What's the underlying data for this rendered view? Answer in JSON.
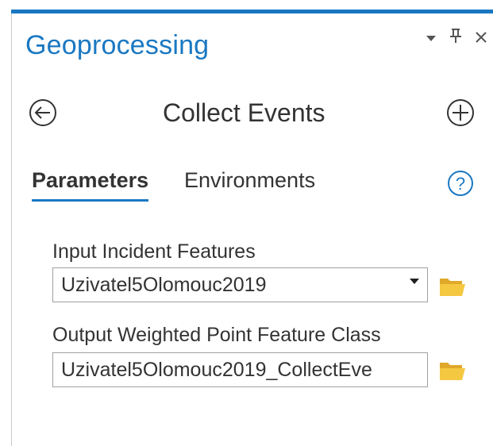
{
  "panel": {
    "title": "Geoprocessing",
    "accent_color": "#1a78c2",
    "controls": [
      {
        "name": "dropdown-menu-icon",
        "glyph": "▾"
      },
      {
        "name": "pin-icon",
        "glyph": "Ⴈ"
      },
      {
        "name": "close-icon",
        "glyph": "✕"
      }
    ]
  },
  "tool": {
    "title": "Collect Events",
    "back_icon": "back-arrow-circle-icon",
    "add_icon": "plus-circle-icon"
  },
  "tabs": [
    {
      "label": "Parameters",
      "active": true
    },
    {
      "label": "Environments",
      "active": false
    }
  ],
  "help_icon": "help-question-icon",
  "fields": {
    "input_incident": {
      "label": "Input Incident Features",
      "value": "Uzivatel5Olomouc2019"
    },
    "output_weighted": {
      "label": "Output Weighted Point Feature Class",
      "value": "Uzivatel5Olomouc2019_CollectEve"
    }
  },
  "folder_color": "#f0c23c"
}
